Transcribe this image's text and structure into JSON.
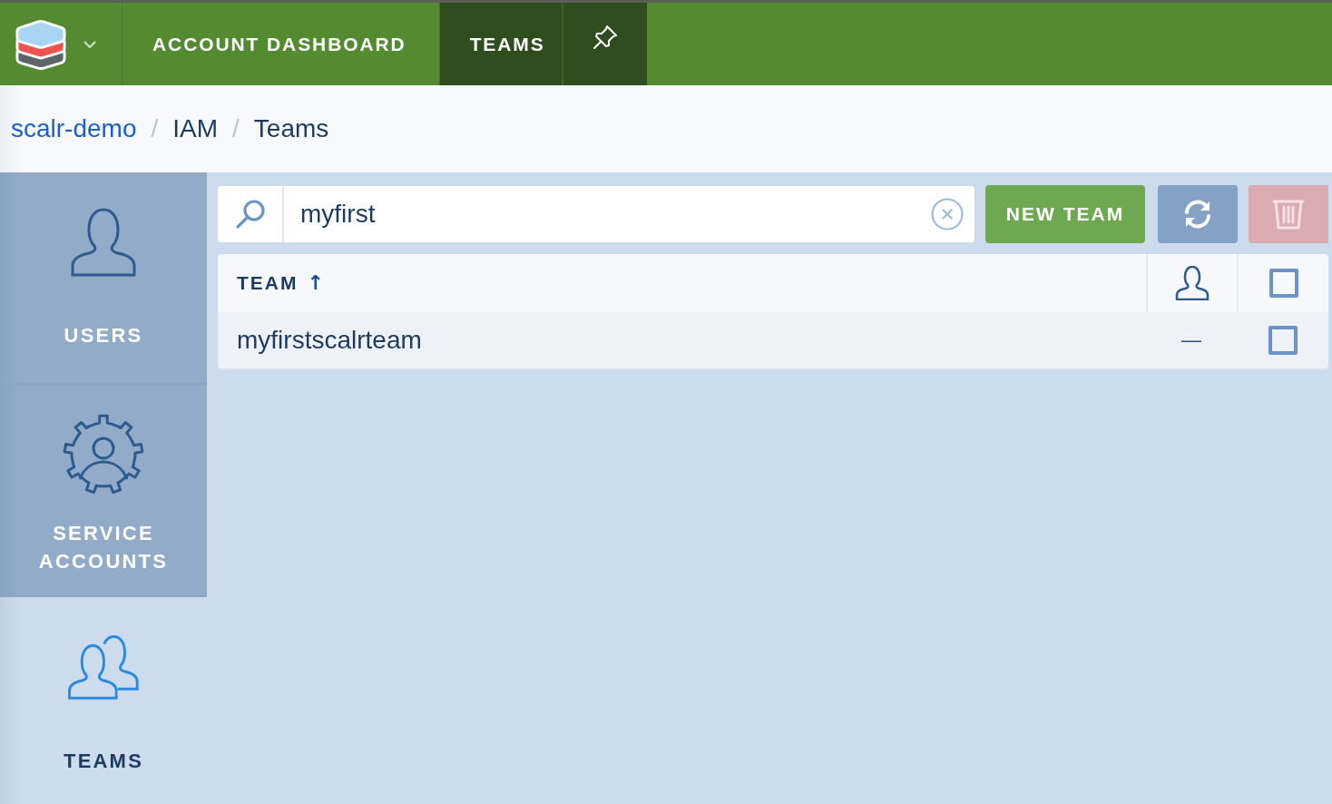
{
  "top_bar": {
    "tabs": [
      {
        "label": "ACCOUNT DASHBOARD",
        "selected": false
      },
      {
        "label": "TEAMS",
        "selected": true
      }
    ]
  },
  "breadcrumb": [
    {
      "label": "scalr-demo",
      "kind": "link"
    },
    {
      "separator": "/",
      "label": "IAM",
      "kind": "text"
    },
    {
      "separator": "/",
      "label": "Teams",
      "kind": "text"
    }
  ],
  "sidebar": {
    "items": [
      {
        "label": "USERS",
        "kind": "user",
        "selected": false
      },
      {
        "label": "SERVICE ACCOUNTS",
        "kind": "service",
        "selected": false
      },
      {
        "label": "TEAMS",
        "kind": "team",
        "selected": true
      }
    ]
  },
  "search": {
    "value": "myfirst"
  },
  "actions": [
    {
      "kind": "primary",
      "label": "NEW TEAM",
      "disabled": false
    },
    {
      "kind": "refresh",
      "disabled": false
    },
    {
      "kind": "delete",
      "disabled": true
    }
  ],
  "table": {
    "columns": [
      {
        "kind": "text",
        "label": "TEAM",
        "sort_arrow": "↑"
      },
      {
        "kind": "icon"
      },
      {
        "kind": "checkbox",
        "checked": false
      }
    ],
    "rows": [
      {
        "team": "myfirstscalrteam",
        "users": "—",
        "checked": false
      }
    ]
  }
}
